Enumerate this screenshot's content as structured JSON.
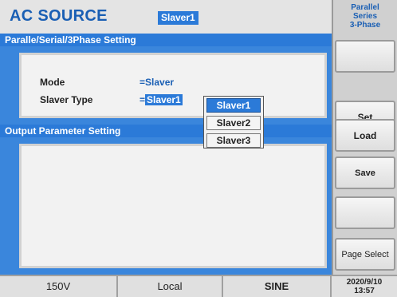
{
  "header": {
    "title": "AC SOURCE",
    "mode_badge": "Slaver1"
  },
  "sidebar": {
    "title_line1": "Parallel",
    "title_line2": "Series",
    "title_line3": "3-Phase",
    "buttons": [
      "",
      "Set",
      "Load",
      "Save",
      "",
      "Page Select"
    ]
  },
  "panel1": {
    "title": "Paralle/Serial/3Phase Setting",
    "mode_label": "Mode",
    "mode_value": "=Slaver",
    "slaver_type_label": "Slaver Type",
    "slaver_type_prefix": "=",
    "slaver_type_value": "Slaver1"
  },
  "dropdown": {
    "options": [
      "Slaver1",
      "Slaver2",
      "Slaver3"
    ],
    "selected": "Slaver1"
  },
  "panel2": {
    "title": "Output Parameter Setting"
  },
  "status": {
    "voltage": "150V",
    "control": "Local",
    "waveform": "SINE",
    "date": "2020/9/10",
    "time": "13:57"
  },
  "colors": {
    "accent": "#2b7ad8",
    "title": "#1a5fb4"
  }
}
